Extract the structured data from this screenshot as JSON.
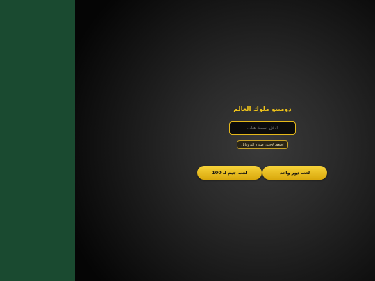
{
  "menu": {
    "title": "دومينو ملوك العالم",
    "name_placeholder": "ادخل اسمك هنا...",
    "avatar_button": "اضغط لاختيار صورة البروفايل",
    "play_100_button": "لعب جيم لـ 100",
    "play_single_round_button": "لعب دور واحد"
  },
  "colors": {
    "side_panel": "#1a4a30",
    "accent_gold": "#f0c419"
  }
}
